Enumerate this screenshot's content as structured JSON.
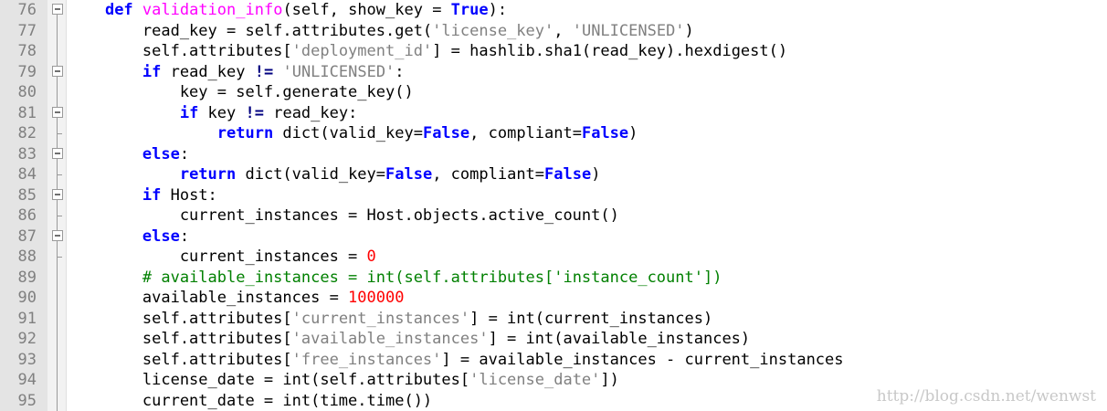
{
  "editor": {
    "lines": [
      {
        "num": "76",
        "fold": "box",
        "tokens": [
          {
            "t": "    "
          },
          {
            "t": "def ",
            "c": "kw"
          },
          {
            "t": "validation_info",
            "c": "fn"
          },
          {
            "t": "(self, show_key = "
          },
          {
            "t": "True",
            "c": "kw"
          },
          {
            "t": "):"
          }
        ]
      },
      {
        "num": "77",
        "fold": "line",
        "tokens": [
          {
            "t": "        read_key = self.attributes.get("
          },
          {
            "t": "'license_key'",
            "c": "str"
          },
          {
            "t": ", "
          },
          {
            "t": "'UNLICENSED'",
            "c": "str"
          },
          {
            "t": ")"
          }
        ]
      },
      {
        "num": "78",
        "fold": "line",
        "tokens": [
          {
            "t": "        self.attributes["
          },
          {
            "t": "'deployment_id'",
            "c": "str"
          },
          {
            "t": "] = hashlib.sha1(read_key).hexdigest()"
          }
        ]
      },
      {
        "num": "79",
        "fold": "box",
        "tokens": [
          {
            "t": "        "
          },
          {
            "t": "if",
            "c": "kw"
          },
          {
            "t": " read_key "
          },
          {
            "t": "!=",
            "c": "op"
          },
          {
            "t": " "
          },
          {
            "t": "'UNLICENSED'",
            "c": "str"
          },
          {
            "t": ":"
          }
        ]
      },
      {
        "num": "80",
        "fold": "line",
        "tokens": [
          {
            "t": "            key = self.generate_key()"
          }
        ]
      },
      {
        "num": "81",
        "fold": "box",
        "tokens": [
          {
            "t": "            "
          },
          {
            "t": "if",
            "c": "kw"
          },
          {
            "t": " key "
          },
          {
            "t": "!=",
            "c": "op"
          },
          {
            "t": " read_key:"
          }
        ]
      },
      {
        "num": "82",
        "fold": "end",
        "tokens": [
          {
            "t": "                "
          },
          {
            "t": "return",
            "c": "kw"
          },
          {
            "t": " dict(valid_key="
          },
          {
            "t": "False",
            "c": "kw"
          },
          {
            "t": ", compliant="
          },
          {
            "t": "False",
            "c": "kw"
          },
          {
            "t": ")"
          }
        ]
      },
      {
        "num": "83",
        "fold": "box",
        "tokens": [
          {
            "t": "        "
          },
          {
            "t": "else",
            "c": "kw"
          },
          {
            "t": ":"
          }
        ]
      },
      {
        "num": "84",
        "fold": "end",
        "tokens": [
          {
            "t": "            "
          },
          {
            "t": "return",
            "c": "kw"
          },
          {
            "t": " dict(valid_key="
          },
          {
            "t": "False",
            "c": "kw"
          },
          {
            "t": ", compliant="
          },
          {
            "t": "False",
            "c": "kw"
          },
          {
            "t": ")"
          }
        ]
      },
      {
        "num": "85",
        "fold": "box",
        "tokens": [
          {
            "t": "        "
          },
          {
            "t": "if",
            "c": "kw"
          },
          {
            "t": " Host:"
          }
        ]
      },
      {
        "num": "86",
        "fold": "end",
        "tokens": [
          {
            "t": "            current_instances = Host.objects.active_count()"
          }
        ]
      },
      {
        "num": "87",
        "fold": "box",
        "tokens": [
          {
            "t": "        "
          },
          {
            "t": "else",
            "c": "kw"
          },
          {
            "t": ":"
          }
        ]
      },
      {
        "num": "88",
        "fold": "end",
        "tokens": [
          {
            "t": "            current_instances = "
          },
          {
            "t": "0",
            "c": "num"
          }
        ]
      },
      {
        "num": "89",
        "fold": "line",
        "tokens": [
          {
            "t": "        "
          },
          {
            "t": "# available_instances = int(self.attributes['instance_count'])",
            "c": "cm"
          }
        ]
      },
      {
        "num": "90",
        "fold": "line",
        "tokens": [
          {
            "t": "        available_instances = "
          },
          {
            "t": "100000",
            "c": "num"
          }
        ]
      },
      {
        "num": "91",
        "fold": "line",
        "tokens": [
          {
            "t": "        self.attributes["
          },
          {
            "t": "'current_instances'",
            "c": "str"
          },
          {
            "t": "] = int(current_instances)"
          }
        ]
      },
      {
        "num": "92",
        "fold": "line",
        "tokens": [
          {
            "t": "        self.attributes["
          },
          {
            "t": "'available_instances'",
            "c": "str"
          },
          {
            "t": "] = int(available_instances)"
          }
        ]
      },
      {
        "num": "93",
        "fold": "line",
        "tokens": [
          {
            "t": "        self.attributes["
          },
          {
            "t": "'free_instances'",
            "c": "str"
          },
          {
            "t": "] = available_instances - current_instances"
          }
        ]
      },
      {
        "num": "94",
        "fold": "line",
        "tokens": [
          {
            "t": "        license_date = int(self.attributes["
          },
          {
            "t": "'license_date'",
            "c": "str"
          },
          {
            "t": "])"
          }
        ]
      },
      {
        "num": "95",
        "fold": "line",
        "tokens": [
          {
            "t": "        current_date = int(time.time())"
          }
        ]
      }
    ]
  },
  "watermark": "http://blog.csdn.net/wenwst"
}
